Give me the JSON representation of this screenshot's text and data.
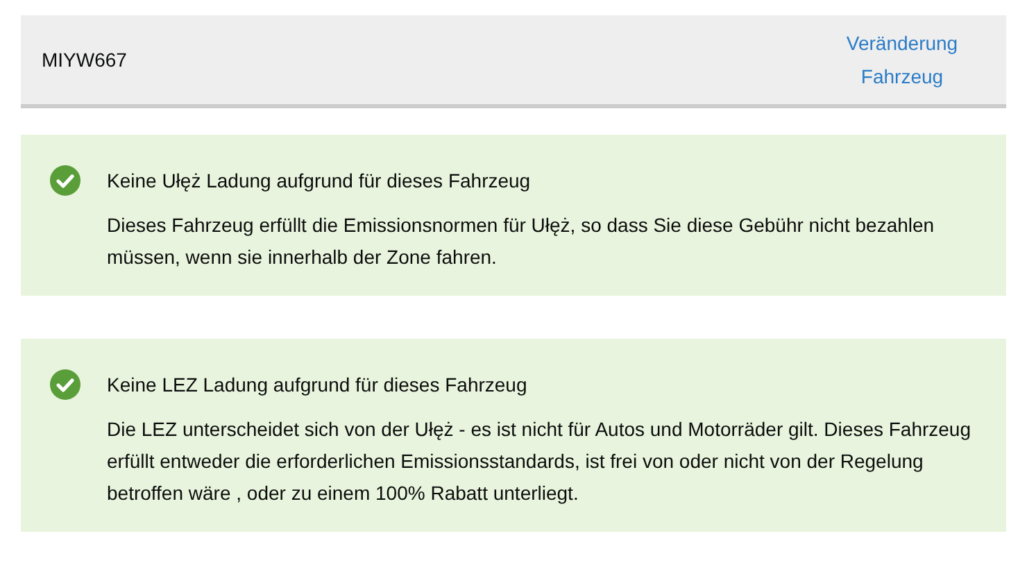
{
  "vehicle": {
    "registration": "MIYW667",
    "change_link": "Veränderung Fahrzeug"
  },
  "results": [
    {
      "kind": "success",
      "title": "Keine Ułęż Ladung aufgrund für dieses Fahrzeug",
      "text": "Dieses Fahrzeug erfüllt die Emissionsnormen für Ułęż, so dass Sie diese Gebühr nicht bezahlen müssen, wenn sie innerhalb der Zone fahren."
    },
    {
      "kind": "success",
      "title": "Keine LEZ Ladung aufgrund für dieses Fahrzeug",
      "text": "Die LEZ unterscheidet sich von der Ułęż - es ist nicht für Autos und Motorräder gilt. Dieses Fahrzeug erfüllt entweder die erforderlichen Emissionsstandards, ist frei von oder nicht von der Regelung betroffen wäre , oder zu einem 100% Rabatt unterliegt."
    }
  ]
}
